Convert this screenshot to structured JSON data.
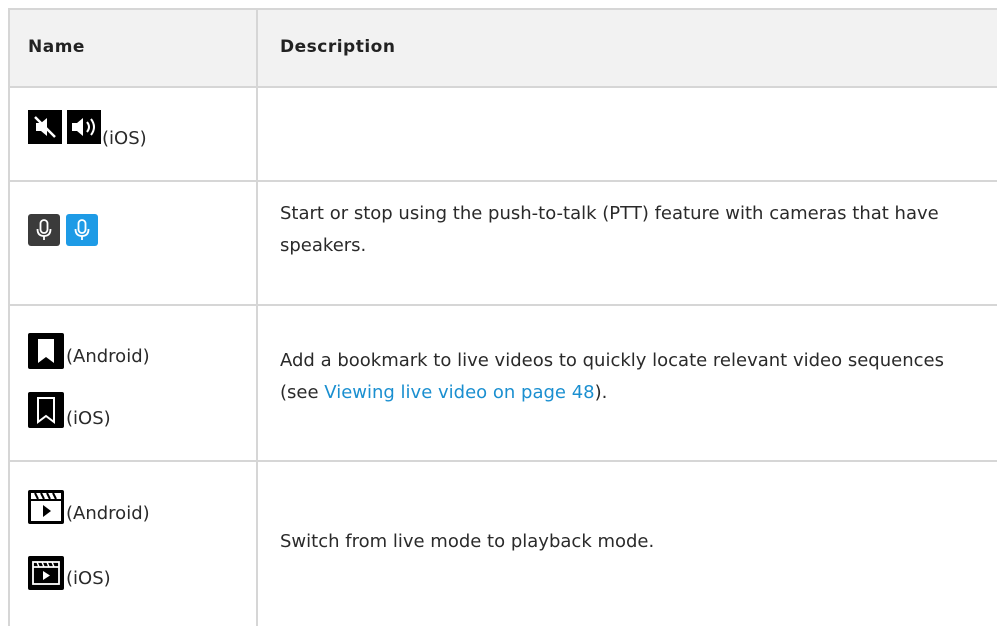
{
  "headers": {
    "name": "Name",
    "description": "Description"
  },
  "rows": [
    {
      "platform": "(iOS)",
      "description": ""
    },
    {
      "description": "Start or stop using the push-to-talk (PTT) feature with cameras that have speakers."
    },
    {
      "platform_a": "(Android)",
      "platform_b": "(iOS)",
      "description_before": "Add a bookmark to live videos to quickly locate relevant video sequences (see ",
      "link": "Viewing live video on page 48",
      "description_after": ")."
    },
    {
      "platform_a": "(Android)",
      "platform_b": "(iOS)",
      "description": "Switch from live mode to playback mode."
    }
  ],
  "icons": [
    "mute-icon",
    "speaker-icon",
    "microphone-icon",
    "microphone-active-icon",
    "bookmark-filled-icon",
    "bookmark-outline-icon",
    "playback-filled-icon",
    "playback-outline-icon"
  ],
  "colors": {
    "header_bg": "#f2f2f2",
    "grid": "#d6d6d6",
    "link": "#1a8fd0",
    "mic_active": "#1e9be6"
  }
}
